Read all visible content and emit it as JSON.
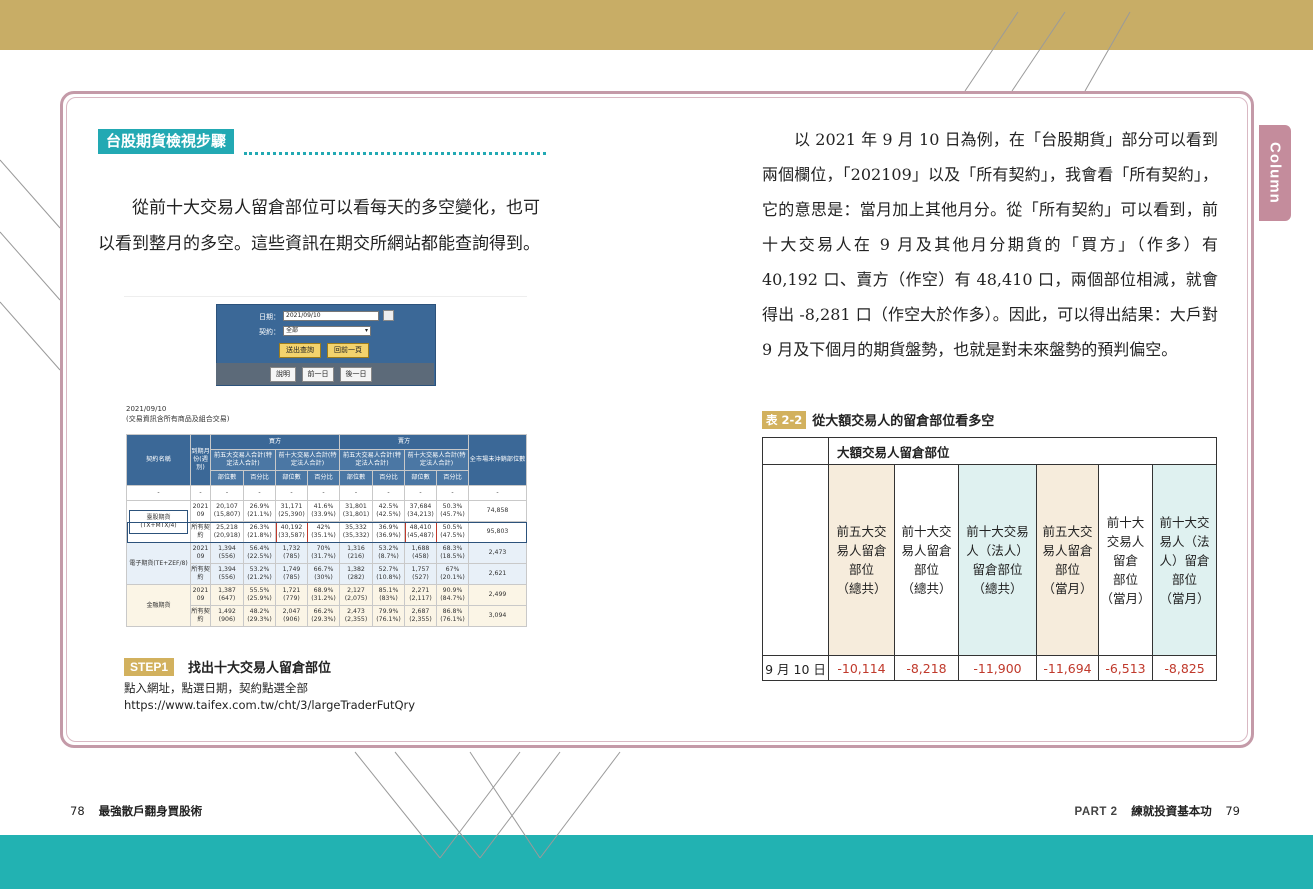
{
  "page": {
    "column_tab": "Column",
    "section_title": "台股期貨檢視步驟",
    "left_paragraph": "從前十大交易人留倉部位可以看每天的多空變化，也可以看到整月的多空。這些資訊在期交所網站都能查詢得到。",
    "right_paragraph": "以 2021 年 9 月 10 日為例，在「台股期貨」部分可以看到兩個欄位，「202109」以及「所有契約」，我會看「所有契約」，它的意思是：當月加上其他月分。從「所有契約」可以看到，前十大交易人在 9 月及其他月分期貨的「買方」（作多）有 40,192 口、賣方（作空）有 48,410 口，兩個部位相減，就會得出 -8,281 口（作空大於作多）。因此，可以得出結果：大戶對 9 月及下個月的期貨盤勢，也就是對未來盤勢的預判偏空。"
  },
  "screenshot": {
    "form": {
      "date_label": "日期：",
      "date_value": "2021/09/10",
      "contract_label": "契約：",
      "contract_value": "全部",
      "submit_button": "送出查詢",
      "back_button": "回前一頁",
      "help_button": "說明",
      "prev_day_button": "前一日",
      "next_day_button": "後一日"
    },
    "date_caption": "2021/09/10",
    "note_caption": "(交易資訊含所有商品及組合交易)",
    "table": {
      "h_contract": "契約名稱",
      "h_month": "到期月份(週別)",
      "h_buy": "買方",
      "h_sell": "賣方",
      "h_oi": "全市場未沖銷部位數",
      "h_top5": "前五大交易人合計(特定法人合計)",
      "h_top10": "前十大交易人合計(特定法人合計)",
      "h_pos": "部位數",
      "h_pct": "百分比",
      "dash": "-",
      "rows": [
        {
          "name": "臺股期貨(TX+MTX/4)",
          "month": "2021 09",
          "b5": "20,107 (15,807)",
          "b5p": "26.9% (21.1%)",
          "b10": "31,171 (25,390)",
          "b10p": "41.6% (33.9%)",
          "s5": "31,801 (31,801)",
          "s5p": "42.5% (42.5%)",
          "s10": "37,684 (34,213)",
          "s10p": "50.3% (45.7%)",
          "oi": "74,858"
        },
        {
          "name": "",
          "month": "所有契約",
          "b5": "25,218 (20,918)",
          "b5p": "26.3% (21.8%)",
          "b10": "40,192 (33,587)",
          "b10p": "42% (35.1%)",
          "s5": "35,332 (35,332)",
          "s5p": "36.9% (36.9%)",
          "s10": "48,410 (45,487)",
          "s10p": "50.5% (47.5%)",
          "oi": "95,803"
        },
        {
          "name": "電子期貨(TE+ZEF/8)",
          "month": "2021 09",
          "b5": "1,394 (556)",
          "b5p": "56.4% (22.5%)",
          "b10": "1,732 (785)",
          "b10p": "70% (31.7%)",
          "s5": "1,316 (216)",
          "s5p": "53.2% (8.7%)",
          "s10": "1,688 (458)",
          "s10p": "68.3% (18.5%)",
          "oi": "2,473"
        },
        {
          "name": "",
          "month": "所有契約",
          "b5": "1,394 (556)",
          "b5p": "53.2% (21.2%)",
          "b10": "1,749 (785)",
          "b10p": "66.7% (30%)",
          "s5": "1,382 (282)",
          "s5p": "52.7% (10.8%)",
          "s10": "1,757 (527)",
          "s10p": "67% (20.1%)",
          "oi": "2,621"
        },
        {
          "name": "金融期貨",
          "month": "2021 09",
          "b5": "1,387 (647)",
          "b5p": "55.5% (25.9%)",
          "b10": "1,721 (779)",
          "b10p": "68.9% (31.2%)",
          "s5": "2,127 (2,075)",
          "s5p": "85.1% (83%)",
          "s10": "2,271 (2,117)",
          "s10p": "90.9% (84.7%)",
          "oi": "2,499"
        },
        {
          "name": "",
          "month": "所有契約",
          "b5": "1,492 (906)",
          "b5p": "48.2% (29.3%)",
          "b10": "2,047 (906)",
          "b10p": "66.2% (29.3%)",
          "s5": "2,473 (2,355)",
          "s5p": "79.9% (76.1%)",
          "s10": "2,687 (2,355)",
          "s10p": "86.8% (76.1%)",
          "oi": "3,094"
        }
      ]
    }
  },
  "step": {
    "badge": "STEP1",
    "title": "找出十大交易人留倉部位",
    "desc_line1": "點入網址，點選日期，契約點選全部",
    "desc_line2": "https://www.taifex.com.tw/cht/3/largeTraderFutQry"
  },
  "table22": {
    "badge": "表 2-2",
    "title": "從大額交易人的留倉部位看多空",
    "group_header": "大額交易人留倉部位",
    "columns": [
      "前五大交易人留倉部位（總共）",
      "前十大交易人留倉部位（總共）",
      "前十大交易人(法人)留倉部位（總共）",
      "前五大交易人留倉部位（當月）",
      "前十大交易人留倉部位（當月）",
      "前十大交易人(法人)留倉部位（當月）"
    ],
    "column_lines": [
      [
        "前五大交",
        "易人留倉",
        "部位",
        "（總共）"
      ],
      [
        "前十大交",
        "易人留倉",
        "部位",
        "（總共）"
      ],
      [
        "前十大交易",
        "人（法人）",
        "留倉部位",
        "（總共）"
      ],
      [
        "前五大交",
        "易人留倉",
        "部位",
        "（當月）"
      ],
      [
        "前十大",
        "交易人",
        "留倉",
        "部位",
        "（當月）"
      ],
      [
        "前十大交",
        "易人（法",
        "人）留倉",
        "部位",
        "（當月）"
      ]
    ],
    "row_label": "9 月 10 日",
    "values": [
      "-10,114",
      "-8,218",
      "-11,900",
      "-11,694",
      "-6,513",
      "-8,825"
    ]
  },
  "footer": {
    "left_page": "78",
    "left_title": "最強散戶翻身買股術",
    "right_part": "PART 2",
    "right_title": "練就投資基本功",
    "right_page": "79"
  },
  "colors": {
    "top_band": "#c8ad66",
    "bottom_band": "#22b2b2",
    "frame": "#c49aa8",
    "accent_teal": "#22a9b3",
    "badge_gold": "#d2b15e",
    "negative_red": "#c0392b"
  }
}
